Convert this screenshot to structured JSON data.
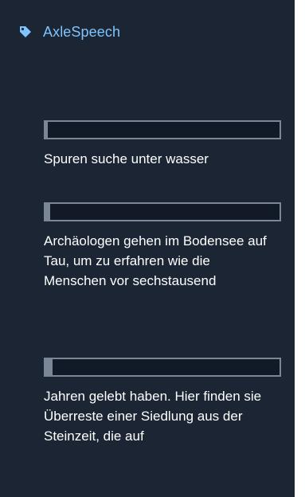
{
  "app": {
    "title": "AxleSpeech",
    "icon": "tag-icon",
    "accent": "#7fc4ff",
    "background": "#1b2533"
  },
  "segments": [
    {
      "progress": 0.01,
      "text": "Spuren suche unter wasser"
    },
    {
      "progress": 0.02,
      "text": "Archäologen gehen im Bodensee auf Tau, um zu erfahren wie die Menschen vor sechstausend"
    },
    {
      "progress": 0.03,
      "text": "Jahren gelebt haben. Hier finden sie Überreste einer Siedlung aus der Steinzeit, die auf"
    }
  ]
}
